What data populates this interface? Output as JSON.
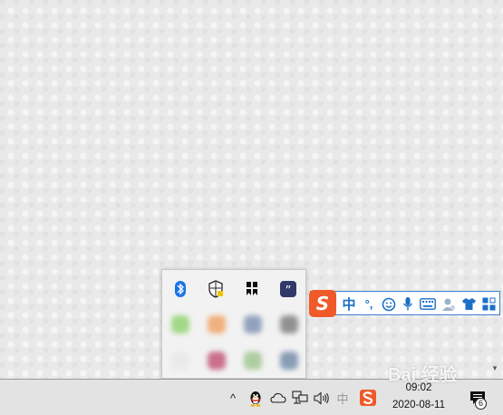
{
  "desktop": {
    "scroll_arrow": "▾"
  },
  "tray_popup": {
    "icons": [
      "bluetooth-icon",
      "security-shield-icon",
      "app-bookmark-icon",
      "quote-app-icon"
    ],
    "blurred_icons": [
      "#8fd16b",
      "#f0a060",
      "#7a8fb0",
      "#7a7a7a",
      "#e8e8e8",
      "#c05070",
      "#9ec48e",
      "#7088a8"
    ]
  },
  "ime_bar": {
    "logo_letter": "S",
    "mode_label": "中",
    "punct_label": "°,",
    "accent_color": "#1a6fc6",
    "logo_color": "#f05a28"
  },
  "taskbar": {
    "chevron": "^",
    "ime_mode": "中",
    "clock_time": "09:02",
    "clock_date": "2020-08-11",
    "notification_count": "6"
  },
  "watermark": {
    "text": "Bai 经验"
  }
}
